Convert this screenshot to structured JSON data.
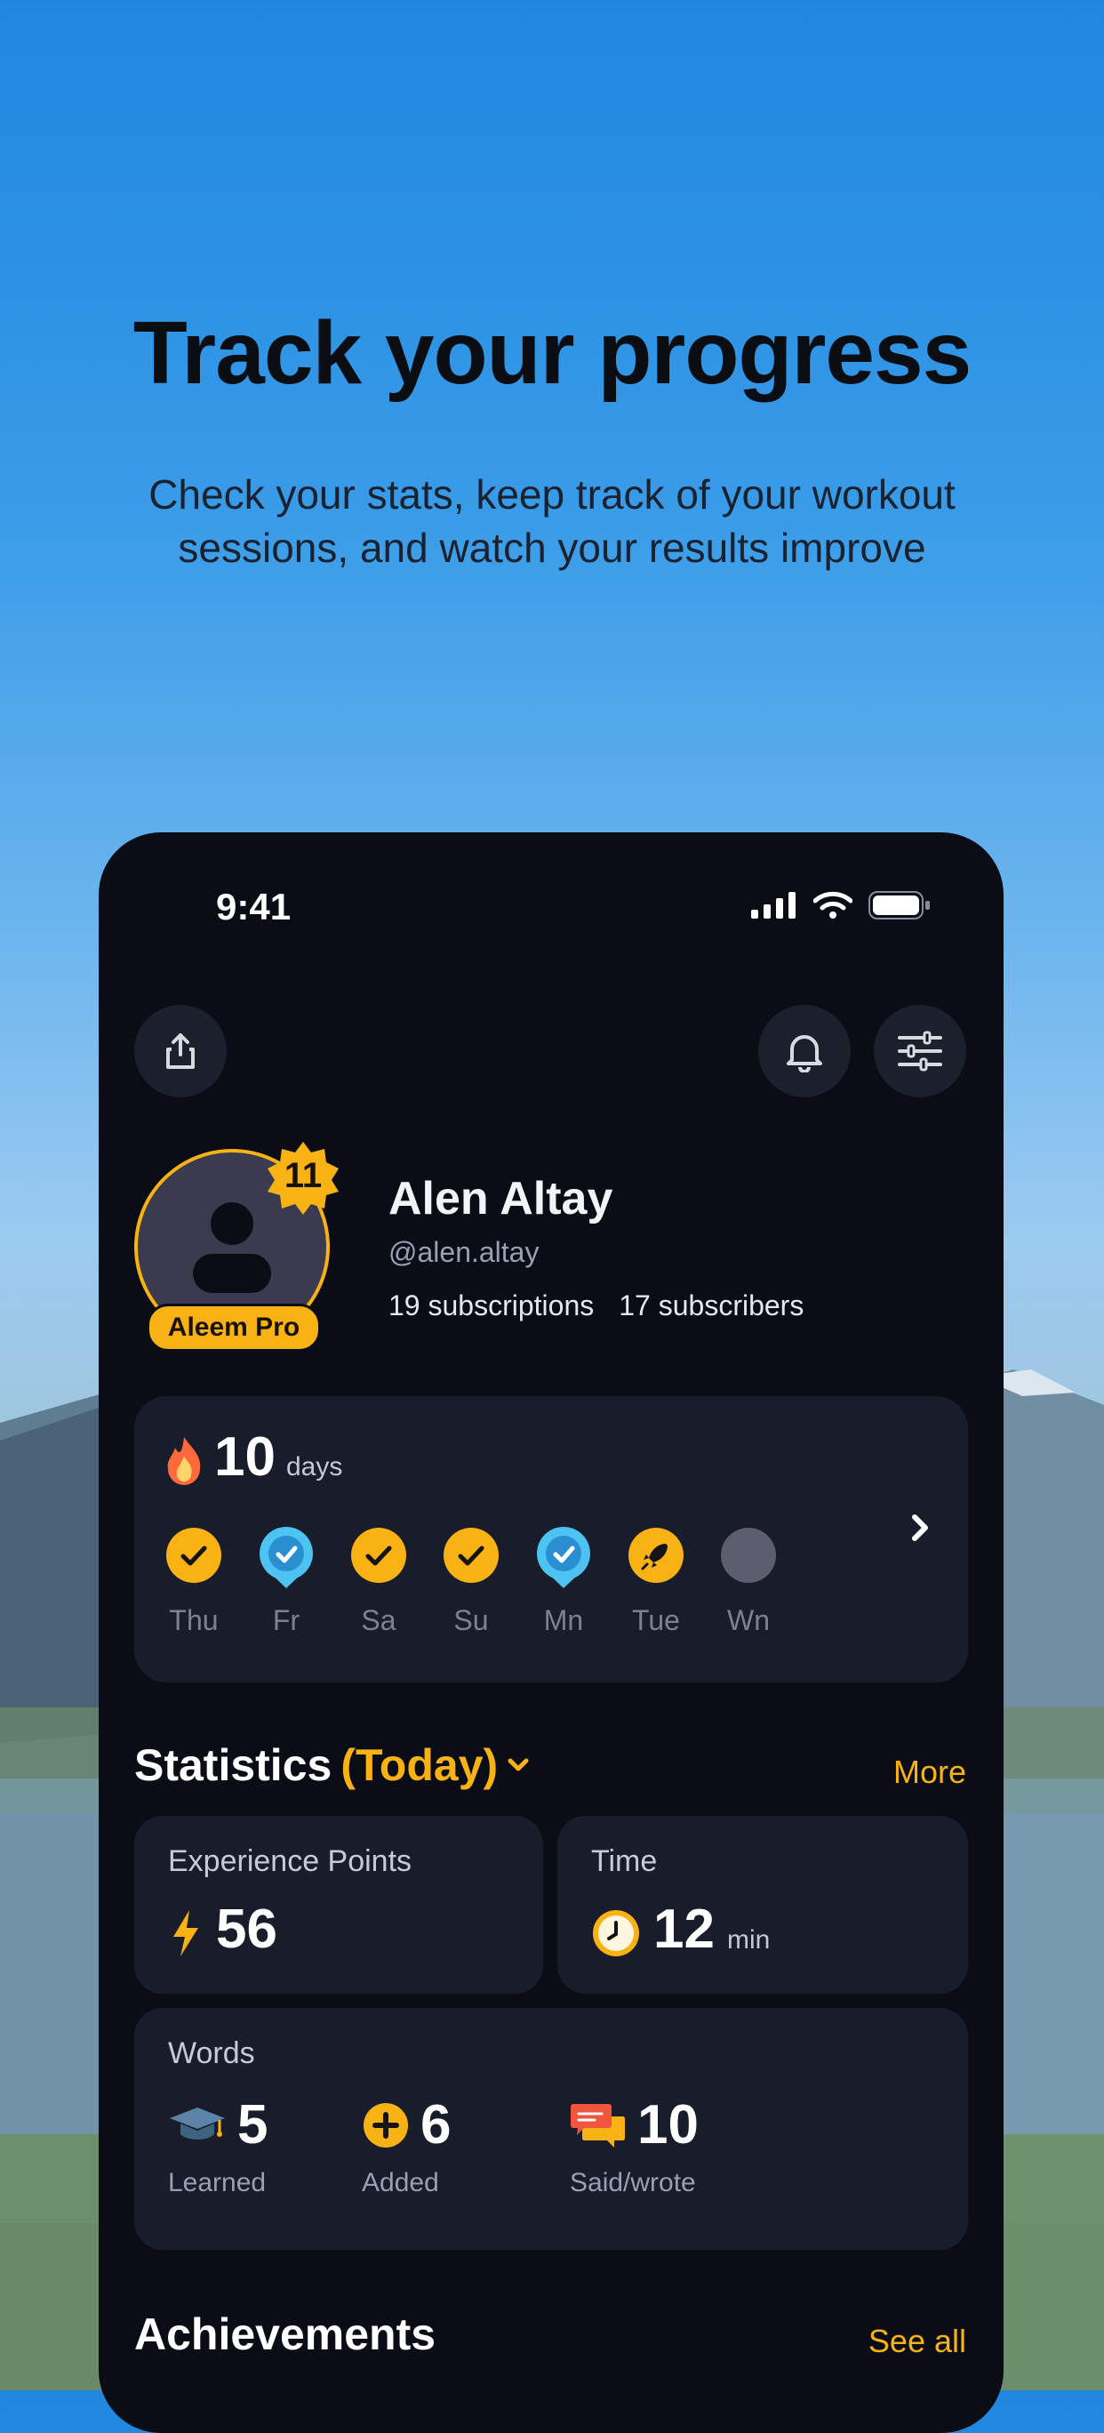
{
  "hero": {
    "title": "Track  your progress",
    "subtitle": "Check your stats, keep track of your workout sessions, and watch your results improve"
  },
  "status_bar": {
    "time": "9:41"
  },
  "profile": {
    "name": "Alen Altay",
    "handle": "@alen.altay",
    "subscriptions": "19 subscriptions",
    "subscribers": "17 subscribers",
    "level": "11",
    "badge": "Aleem Pro"
  },
  "streak": {
    "count": "10",
    "unit": "days",
    "days": [
      {
        "label": "Thu",
        "state": "check"
      },
      {
        "label": "Fr",
        "state": "freeze"
      },
      {
        "label": "Sa",
        "state": "check"
      },
      {
        "label": "Su",
        "state": "check"
      },
      {
        "label": "Mn",
        "state": "freeze"
      },
      {
        "label": "Tue",
        "state": "rocket"
      },
      {
        "label": "Wn",
        "state": "empty"
      }
    ]
  },
  "statistics": {
    "title": "Statistics",
    "period": "(Today)",
    "more": "More",
    "xp_label": "Experience Points",
    "xp_value": "56",
    "time_label": "Time",
    "time_value": "12",
    "time_unit": "min",
    "words_label": "Words",
    "learned_value": "5",
    "learned_label": "Learned",
    "added_value": "6",
    "added_label": "Added",
    "said_value": "10",
    "said_label": "Said/wrote"
  },
  "achievements": {
    "title": "Achievements",
    "see_all": "See all"
  },
  "colors": {
    "accent": "#f8b213",
    "freeze": "#4cc3f0",
    "phone_bg": "#0a0d16",
    "card_bg": "#191c2a"
  }
}
